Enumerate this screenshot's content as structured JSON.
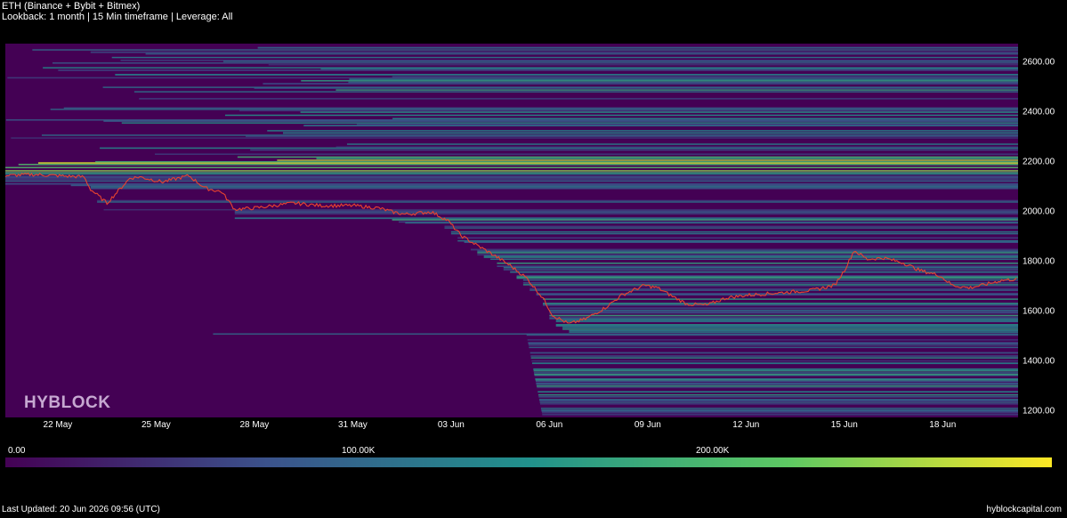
{
  "header": {
    "title": "ETH (Binance + Bybit + Bitmex)",
    "subtitle": "Lookback: 1 month | 15 Min timeframe | Leverage: All"
  },
  "watermark": "HYBLOCK",
  "colorbar": {
    "labels": [
      "0.00",
      "100.00K",
      "200.00K"
    ],
    "values": [
      0,
      100000,
      200000
    ],
    "max": 280000,
    "colors": [
      "#440154",
      "#3b528b",
      "#21918c",
      "#5ec962",
      "#fde725"
    ]
  },
  "footer": {
    "last_updated": "Last Updated: 20 Jun 2026 09:56 (UTC)",
    "site": "hyblockcapital.com"
  },
  "chart_data": {
    "type": "heatmap",
    "title": "ETH (Binance + Bybit + Bitmex)",
    "subtitle": "Lookback: 1 month | 15 Min timeframe | Leverage: All",
    "xlabel": "",
    "ylabel": "",
    "x_ticks": [
      "22 May",
      "25 May",
      "28 May",
      "31 May",
      "03 Jun",
      "06 Jun",
      "09 Jun",
      "12 Jun",
      "15 Jun",
      "18 Jun"
    ],
    "x_tick_days": [
      2,
      5,
      8,
      11,
      14,
      17,
      20,
      23,
      26,
      29
    ],
    "x_range_days": [
      0.4,
      31.3
    ],
    "y_ticks": [
      1200,
      1400,
      1600,
      1800,
      2000,
      2200,
      2400,
      2600
    ],
    "ylim": [
      1170,
      2670
    ],
    "legend": "colorbar-bottom",
    "grid": false,
    "price_series": {
      "name": "",
      "color": "#e8432f",
      "x_days": [
        0.4,
        1.2,
        2.0,
        2.8,
        3.0,
        3.5,
        4.2,
        4.5,
        5.2,
        6.0,
        6.5,
        7.0,
        7.4,
        8.0,
        8.6,
        9.2,
        10.0,
        11.0,
        11.8,
        12.2,
        12.6,
        13.4,
        13.9,
        14.3,
        14.8,
        15.2,
        15.8,
        16.3,
        16.8,
        17.1,
        17.6,
        18.1,
        18.7,
        19.2,
        19.9,
        20.3,
        20.7,
        21.2,
        21.8,
        22.4,
        23.0,
        24.0,
        25.0,
        25.7,
        26.0,
        26.3,
        26.7,
        27.2,
        27.8,
        28.3,
        28.9,
        29.3,
        29.8,
        30.2,
        30.8,
        31.3
      ],
      "prices": [
        2140,
        2145,
        2140,
        2135,
        2085,
        2030,
        2130,
        2135,
        2115,
        2140,
        2090,
        2075,
        2005,
        2010,
        2020,
        2030,
        2020,
        2020,
        2010,
        1995,
        1985,
        1995,
        1960,
        1900,
        1860,
        1830,
        1780,
        1730,
        1650,
        1580,
        1545,
        1565,
        1610,
        1660,
        1700,
        1690,
        1660,
        1625,
        1620,
        1650,
        1660,
        1670,
        1680,
        1700,
        1760,
        1840,
        1805,
        1810,
        1790,
        1760,
        1740,
        1700,
        1690,
        1700,
        1720,
        1725
      ]
    }
  }
}
